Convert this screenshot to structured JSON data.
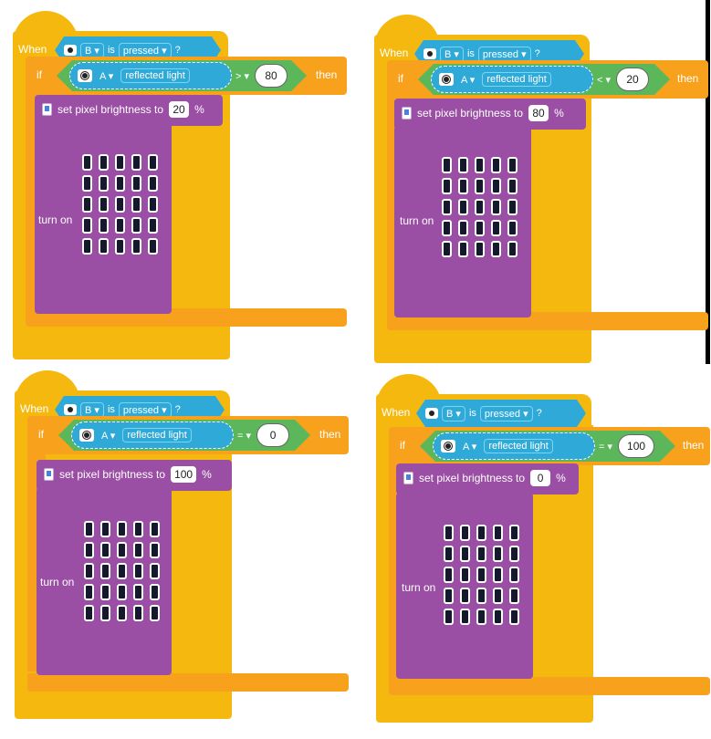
{
  "programs": [
    {
      "when_label": "When",
      "button": "B",
      "event": "is",
      "state": "pressed",
      "question": "?",
      "if_label": "if",
      "port": "A",
      "sensor": "reflected light",
      "operator": ">",
      "threshold": "80",
      "then_label": "then",
      "brightness_label": "set pixel brightness to",
      "brightness": "20",
      "percent": "%",
      "turn_on_label": "turn on"
    },
    {
      "when_label": "When",
      "button": "B",
      "event": "is",
      "state": "pressed",
      "question": "?",
      "if_label": "if",
      "port": "A",
      "sensor": "reflected light",
      "operator": "<",
      "threshold": "20",
      "then_label": "then",
      "brightness_label": "set pixel brightness to",
      "brightness": "80",
      "percent": "%",
      "turn_on_label": "turn on"
    },
    {
      "when_label": "When",
      "button": "B",
      "event": "is",
      "state": "pressed",
      "question": "?",
      "if_label": "if",
      "port": "A",
      "sensor": "reflected light",
      "operator": "=",
      "threshold": "0",
      "then_label": "then",
      "brightness_label": "set pixel brightness to",
      "brightness": "100",
      "percent": "%",
      "turn_on_label": "turn on"
    },
    {
      "when_label": "When",
      "button": "B",
      "event": "is",
      "state": "pressed",
      "question": "?",
      "if_label": "if",
      "port": "A",
      "sensor": "reflected light",
      "operator": "=",
      "threshold": "100",
      "then_label": "then",
      "brightness_label": "set pixel brightness to",
      "brightness": "0",
      "percent": "%",
      "turn_on_label": "turn on"
    }
  ],
  "dropdown_arrow": "▾",
  "colors": {
    "event": "#f5b80f",
    "control": "#f7a11d",
    "sensor": "#2fa9d8",
    "operator": "#5cb65a",
    "display": "#9a4ea4"
  }
}
